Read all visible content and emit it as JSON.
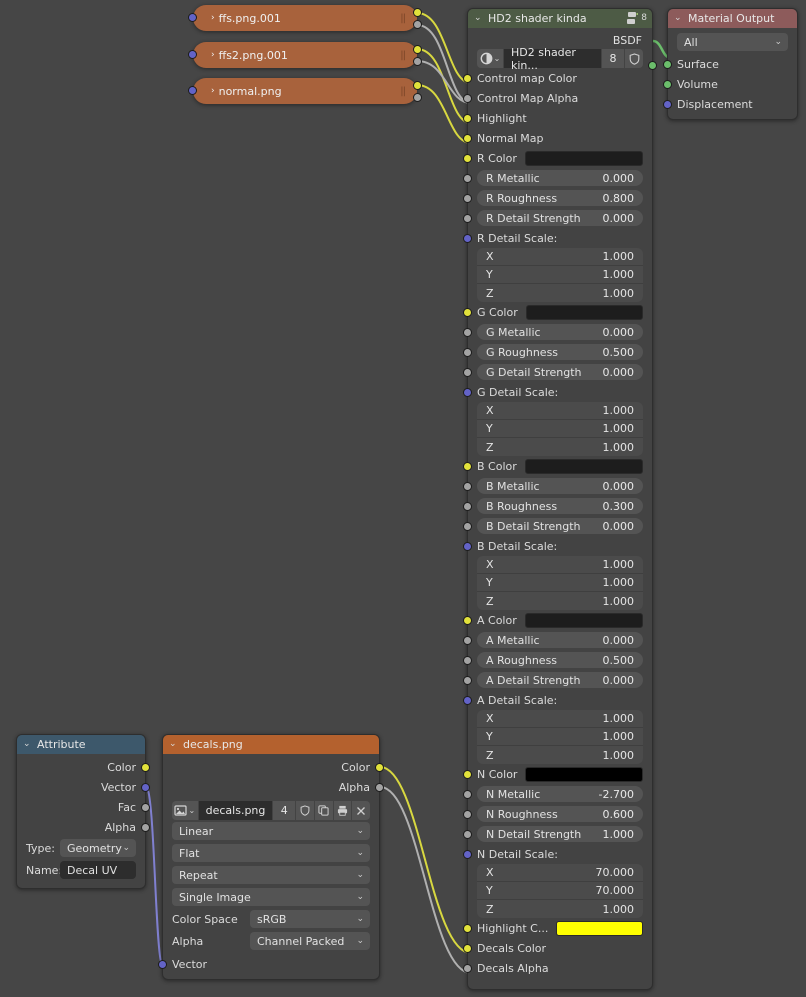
{
  "app": {
    "editor": "blender-shader-node-editor",
    "background_color": "#464646"
  },
  "colors": {
    "socket_yellow": "#e2e23b",
    "socket_grey": "#a3a3a3",
    "socket_purple": "#6363c7",
    "socket_green": "#6bbd6b",
    "header_shader": "#4d5b45",
    "header_output": "#8d5b5b",
    "header_attribute": "#3d586b",
    "header_texture": "#b4612e",
    "link_yellow": "#d8d840",
    "link_grey": "#b0b0b0",
    "link_purple": "#8080d0",
    "link_green": "#6bbd6b"
  },
  "collapsed_nodes": [
    {
      "title": "ffs.png.001",
      "triangle": "›",
      "grip": "||"
    },
    {
      "title": "ffs2.png.001",
      "triangle": "›",
      "grip": "||"
    },
    {
      "title": "normal.png",
      "triangle": "›",
      "grip": "||"
    }
  ],
  "shader_node": {
    "title": "HD2 shader kinda",
    "triangle": "⌄",
    "header_badge": "8",
    "header_icon": "node-group-icon",
    "output_label": "BSDF",
    "datablock": {
      "icon": "node-group-icon",
      "dropdown_chevron": "⌄",
      "name": "HD2 shader kin...",
      "users": "8",
      "shield_icon": "fake-user-shield-icon"
    },
    "inputs": [
      {
        "label": "Control map Color",
        "socket": "yellow",
        "type": "label"
      },
      {
        "label": "Control Map Alpha",
        "socket": "grey",
        "type": "label"
      },
      {
        "label": "Highlight",
        "socket": "yellow",
        "type": "label"
      },
      {
        "label": "Normal Map",
        "socket": "yellow",
        "type": "label"
      },
      {
        "label": "R Color",
        "socket": "yellow",
        "type": "color",
        "color": "#1d1d1d"
      },
      {
        "label": "R Metallic",
        "socket": "grey",
        "type": "value",
        "value": "0.000"
      },
      {
        "label": "R Roughness",
        "socket": "grey",
        "type": "value",
        "value": "0.800"
      },
      {
        "label": "R Detail Strength",
        "socket": "grey",
        "type": "value",
        "value": "0.000"
      },
      {
        "label": "R Detail Scale:",
        "socket": "purple",
        "type": "vector",
        "vector": [
          {
            "axis": "X",
            "value": "1.000"
          },
          {
            "axis": "Y",
            "value": "1.000"
          },
          {
            "axis": "Z",
            "value": "1.000"
          }
        ]
      },
      {
        "label": "G Color",
        "socket": "yellow",
        "type": "color",
        "color": "#1d1d1d"
      },
      {
        "label": "G Metallic",
        "socket": "grey",
        "type": "value",
        "value": "0.000"
      },
      {
        "label": "G Roughness",
        "socket": "grey",
        "type": "value",
        "value": "0.500"
      },
      {
        "label": "G Detail Strength",
        "socket": "grey",
        "type": "value",
        "value": "0.000"
      },
      {
        "label": "G Detail Scale:",
        "socket": "purple",
        "type": "vector",
        "vector": [
          {
            "axis": "X",
            "value": "1.000"
          },
          {
            "axis": "Y",
            "value": "1.000"
          },
          {
            "axis": "Z",
            "value": "1.000"
          }
        ]
      },
      {
        "label": "B Color",
        "socket": "yellow",
        "type": "color",
        "color": "#1d1d1d"
      },
      {
        "label": "B Metallic",
        "socket": "grey",
        "type": "value",
        "value": "0.000"
      },
      {
        "label": "B Roughness",
        "socket": "grey",
        "type": "value",
        "value": "0.300"
      },
      {
        "label": "B Detail Strength",
        "socket": "grey",
        "type": "value",
        "value": "0.000"
      },
      {
        "label": "B Detail Scale:",
        "socket": "purple",
        "type": "vector",
        "vector": [
          {
            "axis": "X",
            "value": "1.000"
          },
          {
            "axis": "Y",
            "value": "1.000"
          },
          {
            "axis": "Z",
            "value": "1.000"
          }
        ]
      },
      {
        "label": "A Color",
        "socket": "yellow",
        "type": "color",
        "color": "#1d1d1d"
      },
      {
        "label": "A Metallic",
        "socket": "grey",
        "type": "value",
        "value": "0.000"
      },
      {
        "label": "A Roughness",
        "socket": "grey",
        "type": "value",
        "value": "0.500"
      },
      {
        "label": "A Detail Strength",
        "socket": "grey",
        "type": "value",
        "value": "0.000"
      },
      {
        "label": "A Detail Scale:",
        "socket": "purple",
        "type": "vector",
        "vector": [
          {
            "axis": "X",
            "value": "1.000"
          },
          {
            "axis": "Y",
            "value": "1.000"
          },
          {
            "axis": "Z",
            "value": "1.000"
          }
        ]
      },
      {
        "label": "N Color",
        "socket": "yellow",
        "type": "color",
        "color": "#000000"
      },
      {
        "label": "N Metallic",
        "socket": "grey",
        "type": "value",
        "value": "-2.700"
      },
      {
        "label": "N Roughness",
        "socket": "grey",
        "type": "value",
        "value": "0.600"
      },
      {
        "label": "N Detail Strength",
        "socket": "grey",
        "type": "value",
        "value": "1.000"
      },
      {
        "label": "N Detail Scale:",
        "socket": "purple",
        "type": "vector",
        "vector": [
          {
            "axis": "X",
            "value": "70.000"
          },
          {
            "axis": "Y",
            "value": "70.000"
          },
          {
            "axis": "Z",
            "value": "1.000"
          }
        ]
      },
      {
        "label": "Highlight C...",
        "socket": "yellow",
        "type": "color",
        "color": "#ffff00"
      },
      {
        "label": "Decals Color",
        "socket": "yellow",
        "type": "label"
      },
      {
        "label": "Decals Alpha",
        "socket": "grey",
        "type": "label"
      }
    ]
  },
  "material_output": {
    "title": "Material Output",
    "triangle": "⌄",
    "target": {
      "value": "All",
      "chevron": "⌄"
    },
    "inputs": [
      {
        "label": "Surface",
        "socket": "green"
      },
      {
        "label": "Volume",
        "socket": "green"
      },
      {
        "label": "Displacement",
        "socket": "purple"
      }
    ]
  },
  "attribute_node": {
    "title": "Attribute",
    "triangle": "⌄",
    "outputs": [
      {
        "label": "Color",
        "socket": "yellow"
      },
      {
        "label": "Vector",
        "socket": "purple"
      },
      {
        "label": "Fac",
        "socket": "grey"
      },
      {
        "label": "Alpha",
        "socket": "grey"
      }
    ],
    "fields": [
      {
        "label": "Type:",
        "value": "Geometry",
        "kind": "dropdown",
        "chevron": "⌄"
      },
      {
        "label": "Name:",
        "value": "Decal UV",
        "kind": "text"
      }
    ]
  },
  "image_texture_node": {
    "title": "decals.png",
    "triangle": "⌄",
    "outputs": [
      {
        "label": "Color",
        "socket": "yellow"
      },
      {
        "label": "Alpha",
        "socket": "grey"
      }
    ],
    "datablock": {
      "icon": "image-icon",
      "dropdown_chevron": "⌄",
      "name": "decals.png",
      "users": "4",
      "buttons": [
        "fake-user-shield-icon",
        "duplicate-icon",
        "pack-icon",
        "close-icon"
      ]
    },
    "dropdowns": [
      {
        "value": "Linear",
        "chevron": "⌄"
      },
      {
        "value": "Flat",
        "chevron": "⌄"
      },
      {
        "value": "Repeat",
        "chevron": "⌄"
      },
      {
        "value": "Single Image",
        "chevron": "⌄"
      }
    ],
    "labeled_dropdowns": [
      {
        "label": "Color Space",
        "value": "sRGB",
        "chevron": "⌄"
      },
      {
        "label": "Alpha",
        "value": "Channel Packed",
        "chevron": "⌄"
      }
    ],
    "input": {
      "label": "Vector",
      "socket": "purple"
    }
  }
}
